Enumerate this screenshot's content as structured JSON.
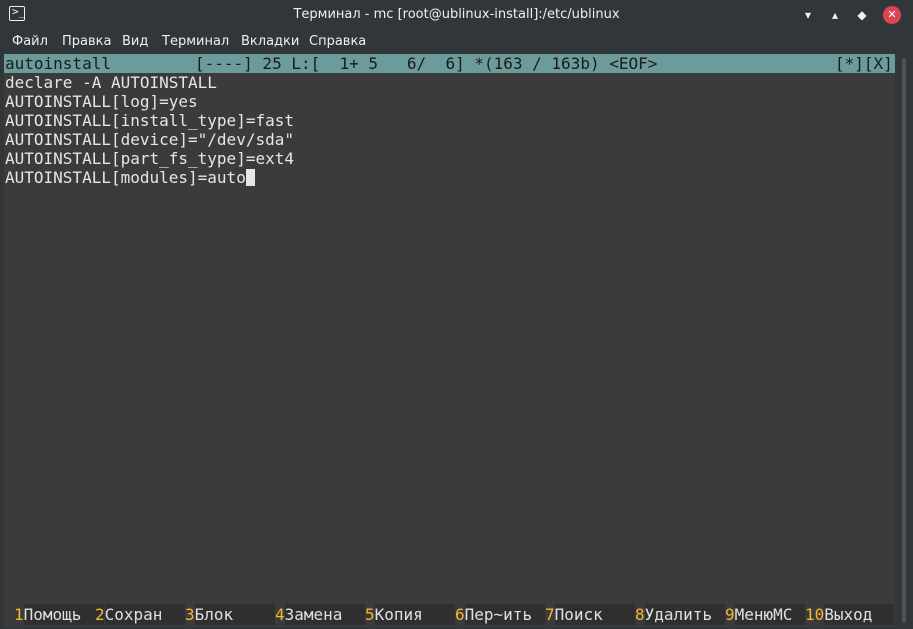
{
  "window": {
    "title": "Терминал - mc [root@ublinux-install]:/etc/ublinux",
    "app_icon": "terminal-icon",
    "buttons": {
      "minimize": "▾",
      "maximize": "▴",
      "keep_above": "◆",
      "close": "✕"
    }
  },
  "menu": {
    "items": [
      "Файл",
      "Правка",
      "Вид",
      "Терминал",
      "Вкладки",
      "Справка"
    ]
  },
  "editor": {
    "status": {
      "filename": "autoinstall",
      "info": "[----] 25 L:[  1+ 5   6/  6] *(163 / 163b) <EOF>",
      "flags": "[*][X]"
    },
    "lines": [
      "declare -A AUTOINSTALL",
      "AUTOINSTALL[log]=yes",
      "AUTOINSTALL[install_type]=fast",
      "AUTOINSTALL[device]=\"/dev/sda\"",
      "AUTOINSTALL[part_fs_type]=ext4",
      "AUTOINSTALL[modules]=auto"
    ]
  },
  "fkeys": [
    {
      "num": "1",
      "label": "Помощь"
    },
    {
      "num": "2",
      "label": "Сохран"
    },
    {
      "num": "3",
      "label": "Блок"
    },
    {
      "num": "4",
      "label": "Замена"
    },
    {
      "num": "5",
      "label": "Копия"
    },
    {
      "num": "6",
      "label": "Пер~ить"
    },
    {
      "num": "7",
      "label": "Поиск"
    },
    {
      "num": "8",
      "label": "Удалить"
    },
    {
      "num": "9",
      "label": "МенюMC"
    },
    {
      "num": "10",
      "label": "Выход"
    }
  ],
  "colors": {
    "status_bar": "#6c9b9b",
    "fkey_number": "#f5b82e",
    "close_button": "#da4453"
  }
}
